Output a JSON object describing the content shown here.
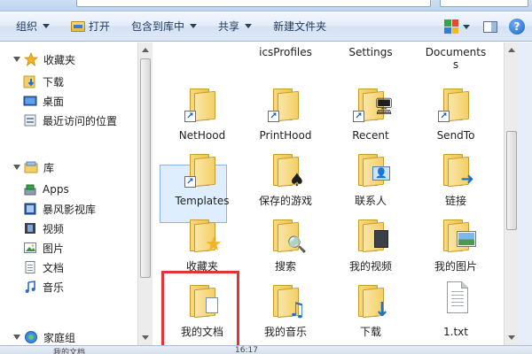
{
  "toolbar": {
    "organize": "组织",
    "open": "打开",
    "include_in_library": "包含到库中",
    "share": "共享",
    "new_folder": "新建文件夹"
  },
  "sidebar": {
    "favorites": {
      "label": "收藏夹",
      "items": [
        "下载",
        "桌面",
        "最近访问的位置"
      ]
    },
    "libraries": {
      "label": "库",
      "items": [
        "Apps",
        "暴风影视库",
        "视频",
        "图片",
        "文档",
        "音乐"
      ]
    },
    "homegroup": "家庭组"
  },
  "content": {
    "items": [
      {
        "label": "icsProfiles",
        "type": "folder"
      },
      {
        "label": "Settings",
        "type": "folder"
      },
      {
        "label": "Documents",
        "type": "folder"
      },
      {
        "label": "NetHood",
        "type": "shortcut-folder"
      },
      {
        "label": "PrintHood",
        "type": "shortcut-folder"
      },
      {
        "label": "Recent",
        "type": "shortcut-folder"
      },
      {
        "label": "SendTo",
        "type": "folder"
      },
      {
        "label": "Templates",
        "type": "shortcut-folder"
      },
      {
        "label": "保存的游戏",
        "type": "folder"
      },
      {
        "label": "联系人",
        "type": "folder"
      },
      {
        "label": "链接",
        "type": "folder"
      },
      {
        "label": "收藏夹",
        "type": "folder"
      },
      {
        "label": "搜索",
        "type": "folder"
      },
      {
        "label": "我的视频",
        "type": "folder"
      },
      {
        "label": "我的图片",
        "type": "folder"
      },
      {
        "label": "我的文档",
        "type": "folder"
      },
      {
        "label": "我的音乐",
        "type": "folder"
      },
      {
        "label": "下载",
        "type": "folder"
      },
      {
        "label": "1.txt",
        "type": "text-file"
      }
    ]
  },
  "status": {
    "name": "我的文档",
    "time": "16:17"
  },
  "colors": {
    "highlight_border": "#e53238",
    "selection_fill": "#dfeeff",
    "folder_yellow": "#f3cf67"
  }
}
